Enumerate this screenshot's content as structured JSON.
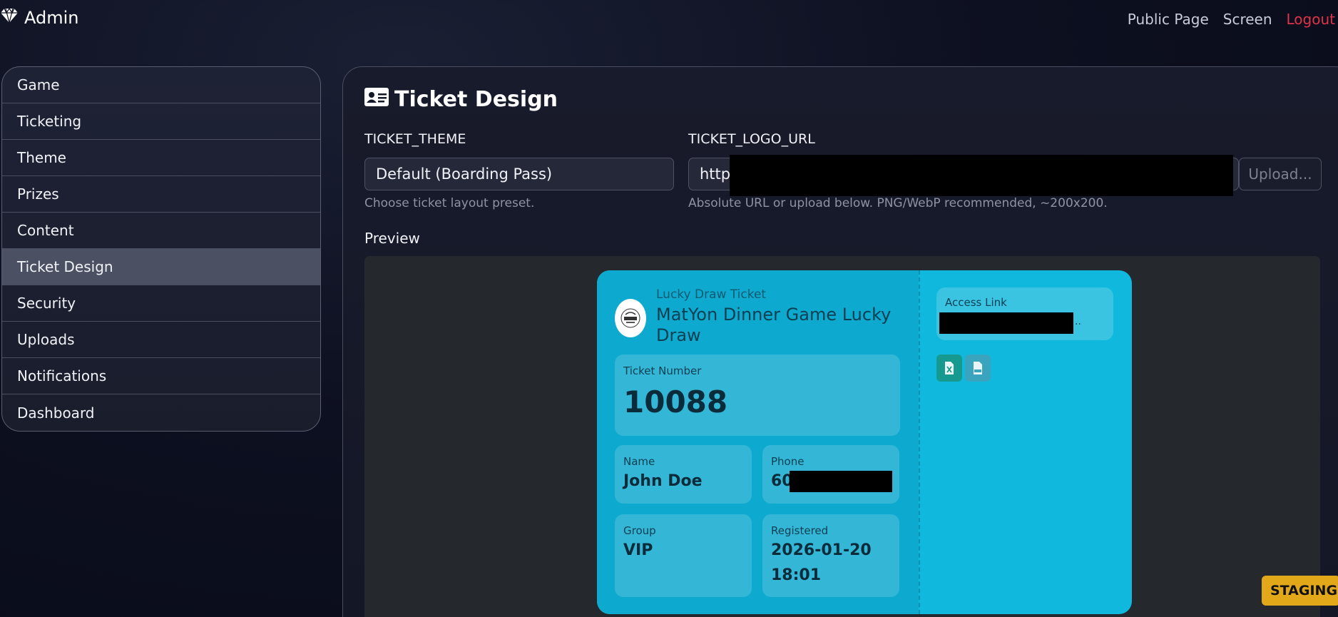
{
  "brand": {
    "title": "Admin",
    "icon": "gem-icon"
  },
  "topnav": {
    "public_page": "Public Page",
    "screen": "Screen",
    "logout": "Logout"
  },
  "sidebar": {
    "items": [
      {
        "label": "Game"
      },
      {
        "label": "Ticketing"
      },
      {
        "label": "Theme"
      },
      {
        "label": "Prizes"
      },
      {
        "label": "Content"
      },
      {
        "label": "Ticket Design",
        "active": true
      },
      {
        "label": "Security"
      },
      {
        "label": "Uploads"
      },
      {
        "label": "Notifications"
      },
      {
        "label": "Dashboard"
      }
    ]
  },
  "main": {
    "title": "Ticket Design",
    "title_icon": "id-card-icon",
    "theme_field": {
      "label": "TICKET_THEME",
      "value": "Default (Boarding Pass)",
      "help": "Choose ticket layout preset."
    },
    "logo_field": {
      "label": "TICKET_LOGO_URL",
      "value": "http",
      "upload_label": "Upload...",
      "help": "Absolute URL or upload below. PNG/WebP recommended, ~200x200."
    },
    "preview_label": "Preview"
  },
  "ticket": {
    "kicker": "Lucky Draw Ticket",
    "title": "MatYon Dinner Game Lucky Draw",
    "ticket_number_label": "Ticket Number",
    "ticket_number": "10088",
    "name_label": "Name",
    "name": "John Doe",
    "phone_label": "Phone",
    "phone": "60",
    "group_label": "Group",
    "group": "VIP",
    "registered_label": "Registered",
    "registered_date": "2026-01-20",
    "registered_time": "18:01",
    "access_link_label": "Access Link",
    "access_link_ellipsis": "..",
    "colors": {
      "ticket_bg": "#0fb8dc",
      "ticket_left": "#0ea9cf"
    }
  },
  "staging_badge": "STAGING",
  "colors": {
    "logout": "#e0334a",
    "staging": "#e2a81a"
  }
}
